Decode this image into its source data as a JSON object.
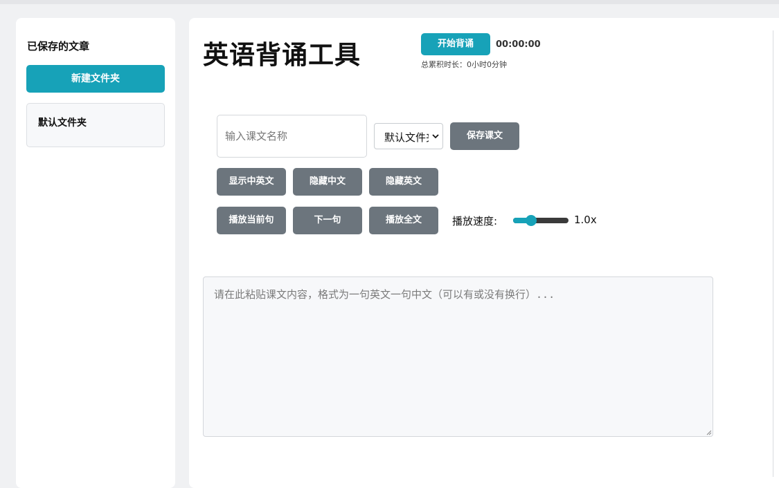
{
  "sidebar": {
    "title": "已保存的文章",
    "new_folder_label": "新建文件夹",
    "folders": [
      {
        "name": "默认文件夹"
      }
    ]
  },
  "header": {
    "title": "英语背诵工具",
    "start_label": "开始背诵",
    "timer": "00:00:00",
    "total_time": "总累积时长：0小时0分钟"
  },
  "editor": {
    "title_placeholder": "输入课文名称",
    "folder_select_value": "默认文件夹",
    "save_label": "保存课文",
    "content_placeholder": "请在此粘贴课文内容，格式为一句英文一句中文（可以有或没有换行）..."
  },
  "display_buttons": {
    "show_both": "显示中英文",
    "hide_chinese": "隐藏中文",
    "hide_english": "隐藏英文"
  },
  "playback": {
    "play_current": "播放当前句",
    "next": "下一句",
    "play_all": "播放全文",
    "speed_label": "播放速度:",
    "speed_value": "1.0x",
    "speed_fraction": 0.33
  },
  "colors": {
    "accent": "#17a2b8",
    "secondary": "#6c757d"
  }
}
